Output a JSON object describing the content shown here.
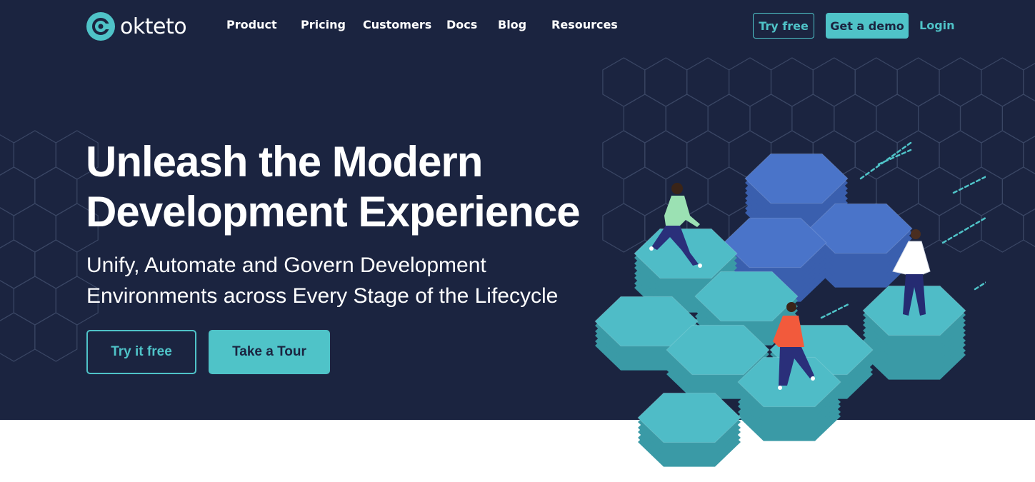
{
  "brand": {
    "name": "okteto",
    "logo_icon": "okteto-logo-icon"
  },
  "nav": {
    "items": [
      {
        "label": "Product"
      },
      {
        "label": "Pricing"
      },
      {
        "label": "Customers"
      },
      {
        "label": "Docs"
      },
      {
        "label": "Blog"
      },
      {
        "label": "Resources"
      }
    ],
    "try_free": "Try free",
    "get_demo": "Get a demo",
    "login": "Login"
  },
  "hero": {
    "headline_line1": "Unleash the Modern",
    "headline_line2": "Development Experience",
    "sub_line1": "Unify, Automate and Govern Development",
    "sub_line2": "Environments across Every Stage of the Lifecycle",
    "primary_cta": "Try it free",
    "secondary_cta": "Take a Tour",
    "illustration": "hexagon-platform-people-illustration"
  },
  "colors": {
    "hero_bg": "#1b2440",
    "accent": "#4fc3c8",
    "hex_dark_blue": "#4a74c9",
    "hex_teal": "#4fbcc7",
    "page_bg": "#ffffff"
  }
}
